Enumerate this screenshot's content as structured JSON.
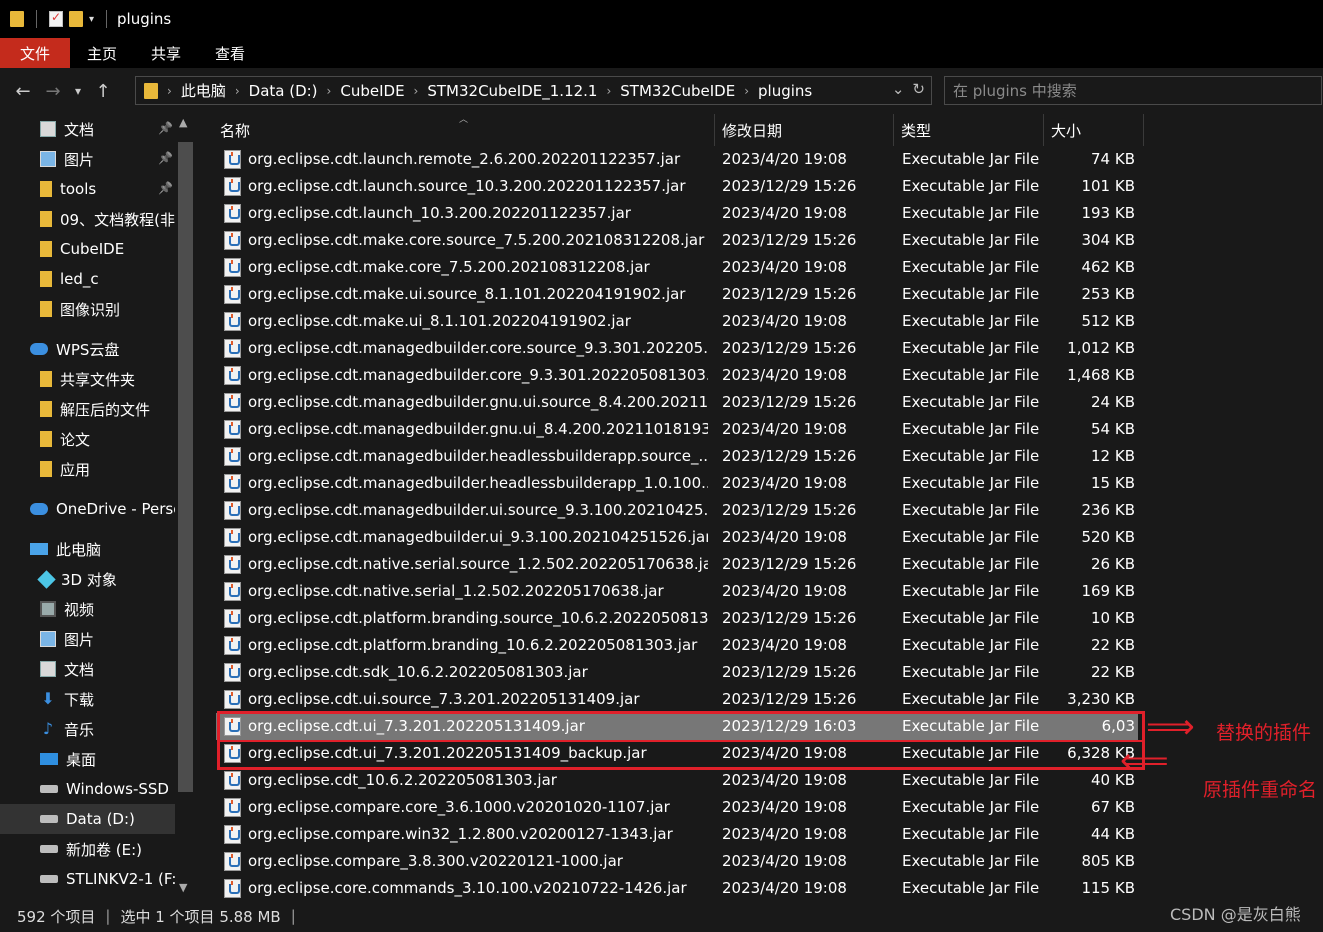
{
  "window": {
    "title": "plugins"
  },
  "ribbon": {
    "tabs": [
      "文件",
      "主页",
      "共享",
      "查看"
    ]
  },
  "address": {
    "crumbs": [
      "此电脑",
      "Data (D:)",
      "CubeIDE",
      "STM32CubeIDE_1.12.1",
      "STM32CubeIDE",
      "plugins"
    ],
    "search_placeholder": "在 plugins 中搜索"
  },
  "sidebar": {
    "items": [
      {
        "label": "文档",
        "icon": "document-icon",
        "pinned": true
      },
      {
        "label": "图片",
        "icon": "pictures-icon",
        "pinned": true
      },
      {
        "label": "tools",
        "icon": "folder-icon",
        "pinned": true
      },
      {
        "label": "09、文档教程(非",
        "icon": "folder-icon"
      },
      {
        "label": "CubeIDE",
        "icon": "folder-icon"
      },
      {
        "label": "led_c",
        "icon": "folder-icon"
      },
      {
        "label": "图像识别",
        "icon": "folder-icon"
      },
      {
        "label": "WPS云盘",
        "icon": "cloud-icon"
      },
      {
        "label": "共享文件夹",
        "icon": "folder-icon"
      },
      {
        "label": "解压后的文件",
        "icon": "folder-icon"
      },
      {
        "label": "论文",
        "icon": "folder-icon"
      },
      {
        "label": "应用",
        "icon": "folder-icon"
      },
      {
        "label": "OneDrive - Perso",
        "icon": "cloud-icon"
      },
      {
        "label": "此电脑",
        "icon": "computer-icon"
      },
      {
        "label": "3D 对象",
        "icon": "3d-objects-icon"
      },
      {
        "label": "视频",
        "icon": "video-icon"
      },
      {
        "label": "图片",
        "icon": "pictures-icon"
      },
      {
        "label": "文档",
        "icon": "document-icon"
      },
      {
        "label": "下载",
        "icon": "download-icon"
      },
      {
        "label": "音乐",
        "icon": "music-icon"
      },
      {
        "label": "桌面",
        "icon": "desktop-icon"
      },
      {
        "label": "Windows-SSD (",
        "icon": "drive-icon"
      },
      {
        "label": "Data (D:)",
        "icon": "drive-icon",
        "selected": true
      },
      {
        "label": "新加卷 (E:)",
        "icon": "drive-icon"
      },
      {
        "label": "STLINKV2-1 (F:)",
        "icon": "drive-icon"
      }
    ]
  },
  "columns": {
    "name": "名称",
    "date": "修改日期",
    "type": "类型",
    "size": "大小"
  },
  "files": [
    {
      "name": "org.eclipse.cdt.launch.remote_2.6.200.202201122357.jar",
      "date": "2023/4/20 19:08",
      "type": "Executable Jar File",
      "size": "74 KB"
    },
    {
      "name": "org.eclipse.cdt.launch.source_10.3.200.202201122357.jar",
      "date": "2023/12/29 15:26",
      "type": "Executable Jar File",
      "size": "101 KB"
    },
    {
      "name": "org.eclipse.cdt.launch_10.3.200.202201122357.jar",
      "date": "2023/4/20 19:08",
      "type": "Executable Jar File",
      "size": "193 KB"
    },
    {
      "name": "org.eclipse.cdt.make.core.source_7.5.200.202108312208.jar",
      "date": "2023/12/29 15:26",
      "type": "Executable Jar File",
      "size": "304 KB"
    },
    {
      "name": "org.eclipse.cdt.make.core_7.5.200.202108312208.jar",
      "date": "2023/4/20 19:08",
      "type": "Executable Jar File",
      "size": "462 KB"
    },
    {
      "name": "org.eclipse.cdt.make.ui.source_8.1.101.202204191902.jar",
      "date": "2023/12/29 15:26",
      "type": "Executable Jar File",
      "size": "253 KB"
    },
    {
      "name": "org.eclipse.cdt.make.ui_8.1.101.202204191902.jar",
      "date": "2023/4/20 19:08",
      "type": "Executable Jar File",
      "size": "512 KB"
    },
    {
      "name": "org.eclipse.cdt.managedbuilder.core.source_9.3.301.202205...",
      "date": "2023/12/29 15:26",
      "type": "Executable Jar File",
      "size": "1,012 KB"
    },
    {
      "name": "org.eclipse.cdt.managedbuilder.core_9.3.301.202205081303...",
      "date": "2023/4/20 19:08",
      "type": "Executable Jar File",
      "size": "1,468 KB"
    },
    {
      "name": "org.eclipse.cdt.managedbuilder.gnu.ui.source_8.4.200.20211...",
      "date": "2023/12/29 15:26",
      "type": "Executable Jar File",
      "size": "24 KB"
    },
    {
      "name": "org.eclipse.cdt.managedbuilder.gnu.ui_8.4.200.20211018193...",
      "date": "2023/4/20 19:08",
      "type": "Executable Jar File",
      "size": "54 KB"
    },
    {
      "name": "org.eclipse.cdt.managedbuilder.headlessbuilderapp.source_...",
      "date": "2023/12/29 15:26",
      "type": "Executable Jar File",
      "size": "12 KB"
    },
    {
      "name": "org.eclipse.cdt.managedbuilder.headlessbuilderapp_1.0.100....",
      "date": "2023/4/20 19:08",
      "type": "Executable Jar File",
      "size": "15 KB"
    },
    {
      "name": "org.eclipse.cdt.managedbuilder.ui.source_9.3.100.20210425...",
      "date": "2023/12/29 15:26",
      "type": "Executable Jar File",
      "size": "236 KB"
    },
    {
      "name": "org.eclipse.cdt.managedbuilder.ui_9.3.100.202104251526.jar",
      "date": "2023/4/20 19:08",
      "type": "Executable Jar File",
      "size": "520 KB"
    },
    {
      "name": "org.eclipse.cdt.native.serial.source_1.2.502.202205170638.jar",
      "date": "2023/12/29 15:26",
      "type": "Executable Jar File",
      "size": "26 KB"
    },
    {
      "name": "org.eclipse.cdt.native.serial_1.2.502.202205170638.jar",
      "date": "2023/4/20 19:08",
      "type": "Executable Jar File",
      "size": "169 KB"
    },
    {
      "name": "org.eclipse.cdt.platform.branding.source_10.6.2.2022050813...",
      "date": "2023/12/29 15:26",
      "type": "Executable Jar File",
      "size": "10 KB"
    },
    {
      "name": "org.eclipse.cdt.platform.branding_10.6.2.202205081303.jar",
      "date": "2023/4/20 19:08",
      "type": "Executable Jar File",
      "size": "22 KB"
    },
    {
      "name": "org.eclipse.cdt.sdk_10.6.2.202205081303.jar",
      "date": "2023/12/29 15:26",
      "type": "Executable Jar File",
      "size": "22 KB"
    },
    {
      "name": "org.eclipse.cdt.ui.source_7.3.201.202205131409.jar",
      "date": "2023/12/29 15:26",
      "type": "Executable Jar File",
      "size": "3,230 KB"
    },
    {
      "name": "org.eclipse.cdt.ui_7.3.201.202205131409.jar",
      "date": "2023/12/29 16:03",
      "type": "Executable Jar File",
      "size": "6,03",
      "selected": true
    },
    {
      "name": "org.eclipse.cdt.ui_7.3.201.202205131409_backup.jar",
      "date": "2023/4/20 19:08",
      "type": "Executable Jar File",
      "size": "6,328 KB"
    },
    {
      "name": "org.eclipse.cdt_10.6.2.202205081303.jar",
      "date": "2023/4/20 19:08",
      "type": "Executable Jar File",
      "size": "40 KB"
    },
    {
      "name": "org.eclipse.compare.core_3.6.1000.v20201020-1107.jar",
      "date": "2023/4/20 19:08",
      "type": "Executable Jar File",
      "size": "67 KB"
    },
    {
      "name": "org.eclipse.compare.win32_1.2.800.v20200127-1343.jar",
      "date": "2023/4/20 19:08",
      "type": "Executable Jar File",
      "size": "44 KB"
    },
    {
      "name": "org.eclipse.compare_3.8.300.v20220121-1000.jar",
      "date": "2023/4/20 19:08",
      "type": "Executable Jar File",
      "size": "805 KB"
    },
    {
      "name": "org.eclipse.core.commands_3.10.100.v20210722-1426.jar",
      "date": "2023/4/20 19:08",
      "type": "Executable Jar File",
      "size": "115 KB"
    }
  ],
  "annotations": {
    "replaced": "替换的插件",
    "renamed": "原插件重命名"
  },
  "status": {
    "count": "592 个项目",
    "selection": "选中 1 个项目 5.88 MB"
  },
  "watermark": "CSDN @是灰白熊",
  "colors": {
    "accent_file_tab": "#c42b1c",
    "annotation": "#e0202a",
    "selected_row": "#777777"
  }
}
